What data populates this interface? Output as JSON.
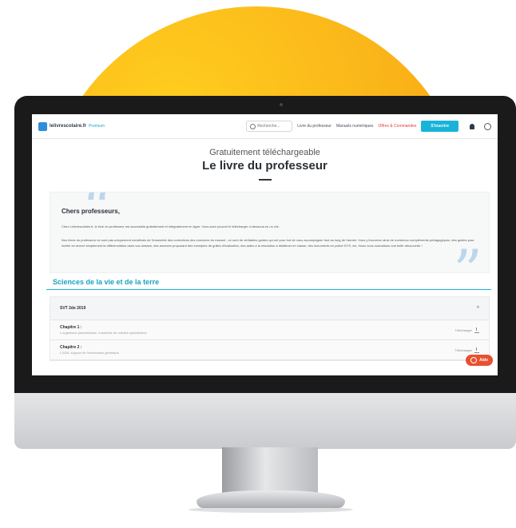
{
  "brand": {
    "name": "lelivrescolaire.fr",
    "badge": "Premium"
  },
  "header": {
    "search_placeholder": "Recherche...",
    "nav": [
      "Livre du professeur",
      "Manuels numériques"
    ],
    "offers": "Offres & Commandes",
    "cta": "S'inscrire"
  },
  "hero": {
    "subtitle": "Gratuitement téléchargeable",
    "title": "Le livre du professeur"
  },
  "quote": {
    "title": "Chers professeurs,",
    "p1": "Chez Lelivrescolaire.fr, le livre du professeur est accessible gratuitement et intégralement en ligne. Vous avez pouvoir le télécharger ci-dessous en un clic.",
    "p2": "Nos livres du professeur ne sont pas uniquement constitués de l'ensemble des corrections des exercices du manuel ; ce sont de véritables guides qui ont pour but de vous accompagner tout au long de l'année. Vous y trouverez ainsi de nombreux compléments pédagogiques, des guides pour mettre en œuvre simplement la différenciation dans vos classes, des annexes proposant des exemples de grilles d'évaluation, des aides à la résolution à distribuer en classe, des documents en police DYS, etc. Nous vous souhaitons une belle découverte !"
  },
  "section": {
    "title": "Sciences de la vie et de la terre"
  },
  "accordion": {
    "title": "SVT 2de 2019",
    "chapters": [
      {
        "title": "Chapitre 1 :",
        "desc": "L'organisme pluricellulaire, ensemble de cellules spécialisées",
        "action": "Télécharger"
      },
      {
        "title": "Chapitre 2 :",
        "desc": "L'ADN, support de l'information génétique",
        "action": "Télécharger"
      }
    ]
  },
  "help": {
    "label": "Aide"
  },
  "colors": {
    "accent": "#18b3d9",
    "orange": "#f59a0c",
    "red": "#e43b3b",
    "help": "#e8502f"
  }
}
